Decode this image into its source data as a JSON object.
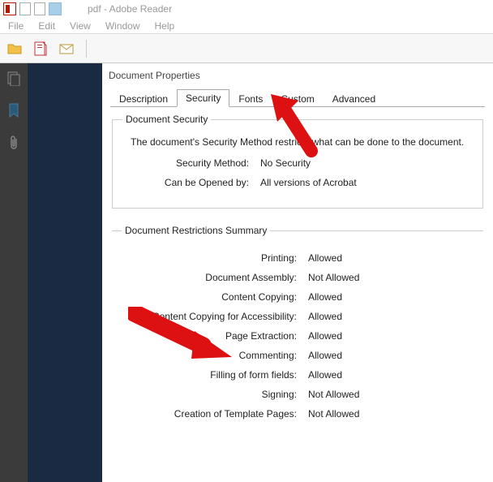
{
  "titlebar": {
    "text": "pdf - Adobe Reader"
  },
  "menubar": {
    "items": [
      "File",
      "Edit",
      "View",
      "Window",
      "Help"
    ]
  },
  "dialog": {
    "title": "Document Properties",
    "tabs": [
      "Description",
      "Security",
      "Fonts",
      "Custom",
      "Advanced"
    ],
    "active_tab": "Security",
    "security": {
      "group_label": "Document Security",
      "info": "The document's Security Method restricts what can be done to the document.",
      "method_label": "Security Method:",
      "method_value": "No Security",
      "opened_label": "Can be Opened by:",
      "opened_value": "All versions of Acrobat"
    },
    "restrictions": {
      "group_label": "Document Restrictions Summary",
      "rows": [
        {
          "label": "Printing:",
          "value": "Allowed"
        },
        {
          "label": "Document Assembly:",
          "value": "Not Allowed"
        },
        {
          "label": "Content Copying:",
          "value": "Allowed"
        },
        {
          "label": "Content Copying for Accessibility:",
          "value": "Allowed"
        },
        {
          "label": "Page Extraction:",
          "value": "Allowed"
        },
        {
          "label": "Commenting:",
          "value": "Allowed"
        },
        {
          "label": "Filling of form fields:",
          "value": "Allowed"
        },
        {
          "label": "Signing:",
          "value": "Not Allowed"
        },
        {
          "label": "Creation of Template Pages:",
          "value": "Not Allowed"
        }
      ]
    }
  }
}
